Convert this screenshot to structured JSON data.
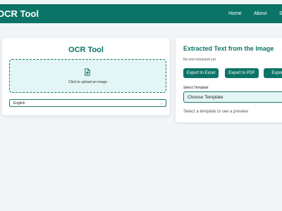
{
  "navbar": {
    "brand": "OCR Tool",
    "links": [
      "Home",
      "About",
      "S"
    ]
  },
  "upload_card": {
    "title": "OCR Tool",
    "upload_prompt": "Click to upload an image",
    "upload_icon": "file-upload-icon",
    "language": "English"
  },
  "result_card": {
    "title": "Extracted Text from the Image",
    "empty_text": "No text extracted yet.",
    "export_buttons": [
      "Export to Excel",
      "Export to PDF",
      "Export"
    ],
    "template_label": "Select Template",
    "template_value": "Choose Template",
    "preview_hint": "Select a template to see a preview."
  },
  "colors": {
    "primary": "#0c7466",
    "upload_bg": "#e3f5f4",
    "page_bg": "#f2f5f8"
  }
}
